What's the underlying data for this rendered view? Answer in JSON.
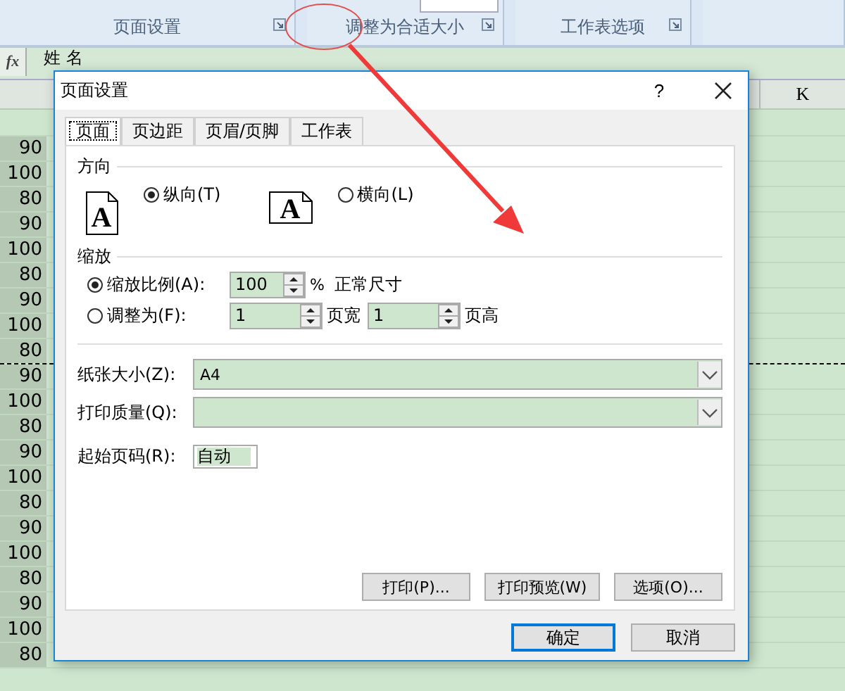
{
  "ribbon": {
    "groups": [
      {
        "label": "页面设置"
      },
      {
        "label": "调整为合适大小"
      },
      {
        "label": "工作表选项"
      }
    ]
  },
  "formula_bar": {
    "fx": "fx",
    "value": "姓 名"
  },
  "sheet": {
    "column_header": "K",
    "cells": [
      "90",
      "100",
      "80",
      "90",
      "100",
      "80",
      "90",
      "100",
      "80",
      "90",
      "100",
      "80",
      "90",
      "100",
      "80",
      "90",
      "100",
      "80",
      "90",
      "100",
      "80"
    ]
  },
  "dialog": {
    "title": "页面设置",
    "help": "?",
    "tabs": [
      {
        "label": "页面",
        "selected": true
      },
      {
        "label": "页边距",
        "selected": false
      },
      {
        "label": "页眉/页脚",
        "selected": false
      },
      {
        "label": "工作表",
        "selected": false
      }
    ],
    "orientation": {
      "heading": "方向",
      "options": [
        {
          "label": "纵向(T)",
          "selected": true,
          "kind": "portrait",
          "icon_letter": "A"
        },
        {
          "label": "横向(L)",
          "selected": false,
          "kind": "landscape",
          "icon_letter": "A"
        }
      ]
    },
    "scaling": {
      "heading": "缩放",
      "options": [
        {
          "label": "缩放比例(A):",
          "selected": true
        },
        {
          "label": "调整为(F):",
          "selected": false
        }
      ],
      "scale_value": "100",
      "percent": "%",
      "scale_note": "正常尺寸",
      "pages_wide": "1",
      "pages_wide_label": "页宽",
      "pages_tall": "1",
      "pages_tall_label": "页高"
    },
    "paper_size": {
      "label": "纸张大小(Z):",
      "value": "A4"
    },
    "print_quality": {
      "label": "打印质量(Q):"
    },
    "first_page": {
      "label": "起始页码(R):",
      "value": "自动"
    },
    "action_buttons": [
      "打印(P)...",
      "打印预览(W)",
      "选项(O)..."
    ],
    "buttons": [
      {
        "label": "确定",
        "default": true
      },
      {
        "label": "取消",
        "default": false
      }
    ]
  }
}
